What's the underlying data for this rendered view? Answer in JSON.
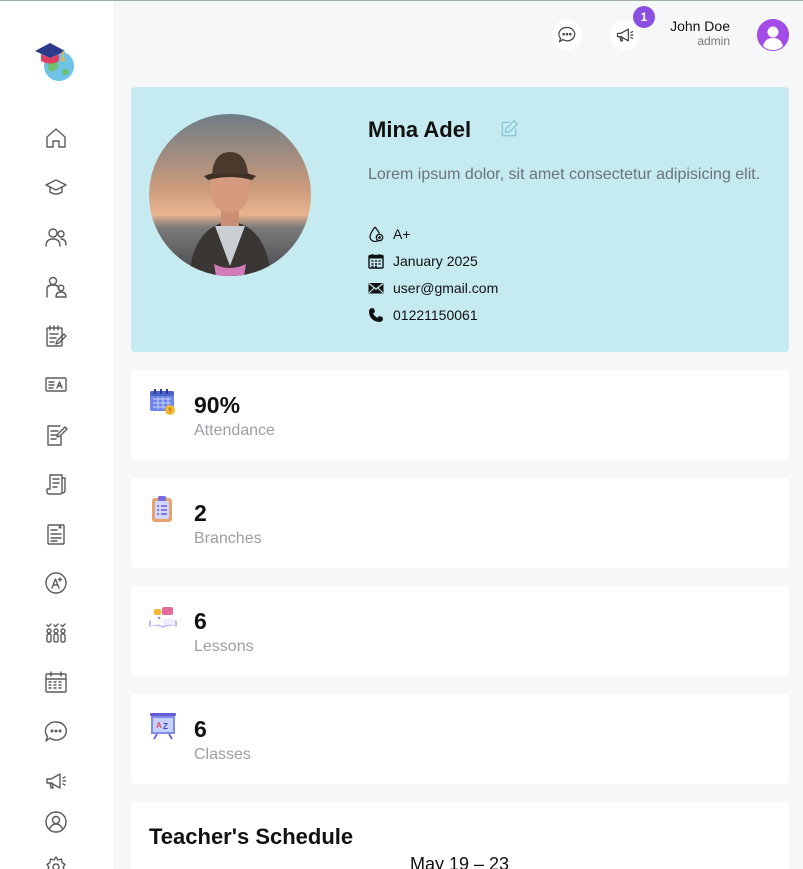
{
  "header": {
    "user_name": "John Doe",
    "user_role": "admin",
    "notification_count": "1"
  },
  "sidebar": {
    "items": [
      {
        "icon": "home-icon"
      },
      {
        "icon": "graduation-cap-icon"
      },
      {
        "icon": "users-icon"
      },
      {
        "icon": "parents-icon"
      },
      {
        "icon": "clipboard-edit-icon"
      },
      {
        "icon": "id-card-icon"
      },
      {
        "icon": "document-edit-icon"
      },
      {
        "icon": "exam-papers-icon"
      },
      {
        "icon": "report-icon"
      },
      {
        "icon": "grade-icon"
      },
      {
        "icon": "attendance-icon"
      },
      {
        "icon": "calendar-icon"
      },
      {
        "icon": "chat-icon"
      },
      {
        "icon": "megaphone-icon"
      },
      {
        "icon": "profile-icon"
      },
      {
        "icon": "settings-icon"
      }
    ]
  },
  "profile": {
    "name": "Mina Adel",
    "description": "Lorem ipsum dolor, sit amet consectetur adipisicing elit.",
    "blood_type": "A+",
    "date": "January 2025",
    "email": "user@gmail.com",
    "phone": "01221150061"
  },
  "stats": [
    {
      "value": "90%",
      "label": "Attendance",
      "icon": "attendance-calendar-icon"
    },
    {
      "value": "2",
      "label": "Branches",
      "icon": "clipboard-icon"
    },
    {
      "value": "6",
      "label": "Lessons",
      "icon": "lessons-book-icon"
    },
    {
      "value": "6",
      "label": "Classes",
      "icon": "classroom-board-icon"
    }
  ],
  "schedule": {
    "title": "Teacher's Schedule",
    "range": "May 19 – 23"
  },
  "colors": {
    "accent": "#8a4fe0",
    "profile_bg": "#c5eaf0",
    "page_bg": "#f6f7f9"
  }
}
